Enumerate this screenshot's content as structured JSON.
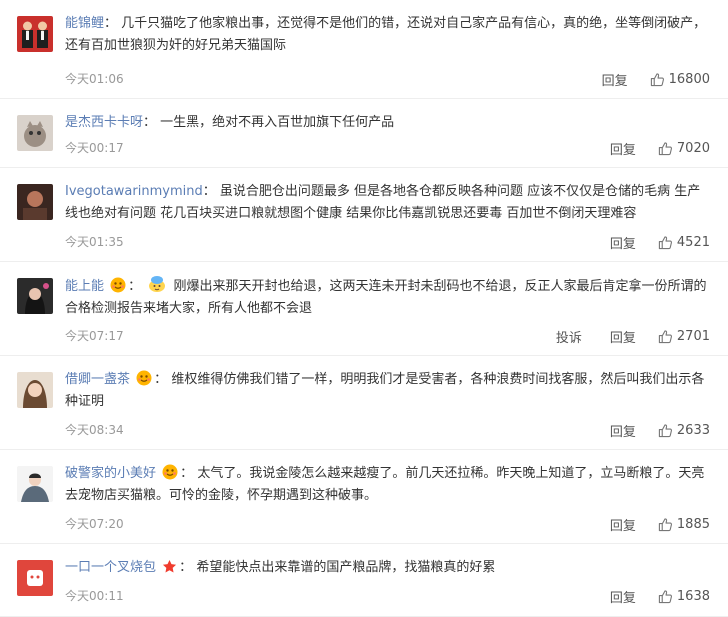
{
  "labels": {
    "reply": "回复",
    "report": "投诉"
  },
  "comments": [
    {
      "user": "能锦鲤",
      "text": "几千只猫吃了他家粮出事，还觉得不是他们的错，还说对自己家产品有信心，真的绝，坐等倒闭破产，还有百加世狼狈为奸的好兄弟天猫国际",
      "time": "今天01:06",
      "likes": "16800"
    },
    {
      "user": "是杰西卡卡呀",
      "text": "一生黑，绝对不再入百世加旗下任何产品",
      "time": "今天00:17",
      "likes": "7020"
    },
    {
      "user": "Ivegotawarinmymind",
      "text": "虽说合肥仓出问题最多 但是各地各仓都反映各种问题 应该不仅仅是仓储的毛病 生产线也绝对有问题 花几百块买进口粮就想图个健康 结果你比伟嘉凯锐思还要毒 百加世不倒闭天理难容",
      "time": "今天01:35",
      "likes": "4521"
    },
    {
      "user": "能上能",
      "text": "刚爆出来那天开封也给退，这两天连未开封未刮码也不给退，反正人家最后肯定拿一份所谓的合格检测报告来堵大家，所有人他都不会退",
      "time": "今天07:17",
      "likes": "2701"
    },
    {
      "user": "借卿一盏茶",
      "text": "维权维得仿佛我们错了一样，明明我们才是受害者，各种浪费时间找客服，然后叫我们出示各种证明",
      "time": "今天08:34",
      "likes": "2633"
    },
    {
      "user": "破警家的小美好",
      "text": "太气了。我说金陵怎么越来越瘦了。前几天还拉稀。昨天晚上知道了，立马断粮了。天亮去宠物店买猫粮。可怜的金陵，怀孕期遇到这种破事。",
      "time": "今天07:20",
      "likes": "1885"
    },
    {
      "user": "一口一个叉烧包",
      "text": "希望能快点出来靠谱的国产粮品牌，找猫粮真的好累",
      "time": "今天00:11",
      "likes": "1638"
    }
  ]
}
